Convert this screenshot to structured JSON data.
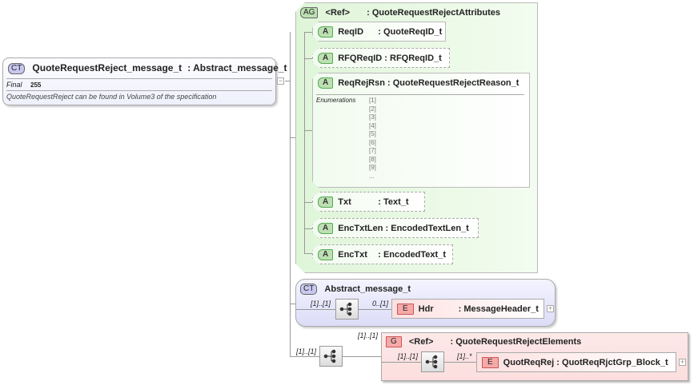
{
  "main": {
    "badge": "CT",
    "name": "QuoteRequestReject_message_t",
    "base": ": Abstract_message_t",
    "final_label": "Final",
    "final_value": "255",
    "description": "QuoteRequestReject can be found in Volume3 of the specification"
  },
  "attribute_group": {
    "badge": "AG",
    "ref": "<Ref>",
    "type": ": QuoteRequestRejectAttributes",
    "attributes": [
      {
        "badge": "A",
        "name": "ReqID",
        "type": ": QuoteReqID_t"
      },
      {
        "badge": "A",
        "name": "RFQReqID",
        "type": ": RFQReqID_t"
      },
      {
        "badge": "A",
        "name": "ReqRejRsn",
        "type": ": QuoteRequestRejectReason_t",
        "enum_label": "Enumerations",
        "enums": [
          "[1]",
          "[2]",
          "[3]",
          "[4]",
          "[5]",
          "[6]",
          "[7]",
          "[8]",
          "[9]",
          "..."
        ]
      },
      {
        "badge": "A",
        "name": "Txt",
        "type": ": Text_t"
      },
      {
        "badge": "A",
        "name": "EncTxtLen",
        "type": ": EncodedTextLen_t"
      },
      {
        "badge": "A",
        "name": "EncTxt",
        "type": ": EncodedText_t"
      }
    ]
  },
  "abstract": {
    "badge": "CT",
    "name": "Abstract_message_t",
    "seq_mult": "[1]..[1]",
    "elem_mult": "0..[1]",
    "elem": {
      "badge": "E",
      "name": "Hdr",
      "type": ": MessageHeader_t"
    }
  },
  "group": {
    "outer_mult": "[1]..[1]",
    "seq_mult": "[1]..[1]",
    "badge": "G",
    "ref": "<Ref>",
    "type": ": QuoteRequestRejectElements",
    "inner_seq_mult": "[1]..[1]",
    "elem_mult": "[1]..*",
    "elem": {
      "badge": "E",
      "name": "QuotReqRej",
      "type": ": QuotReqRjctGrp_Block_t"
    }
  }
}
